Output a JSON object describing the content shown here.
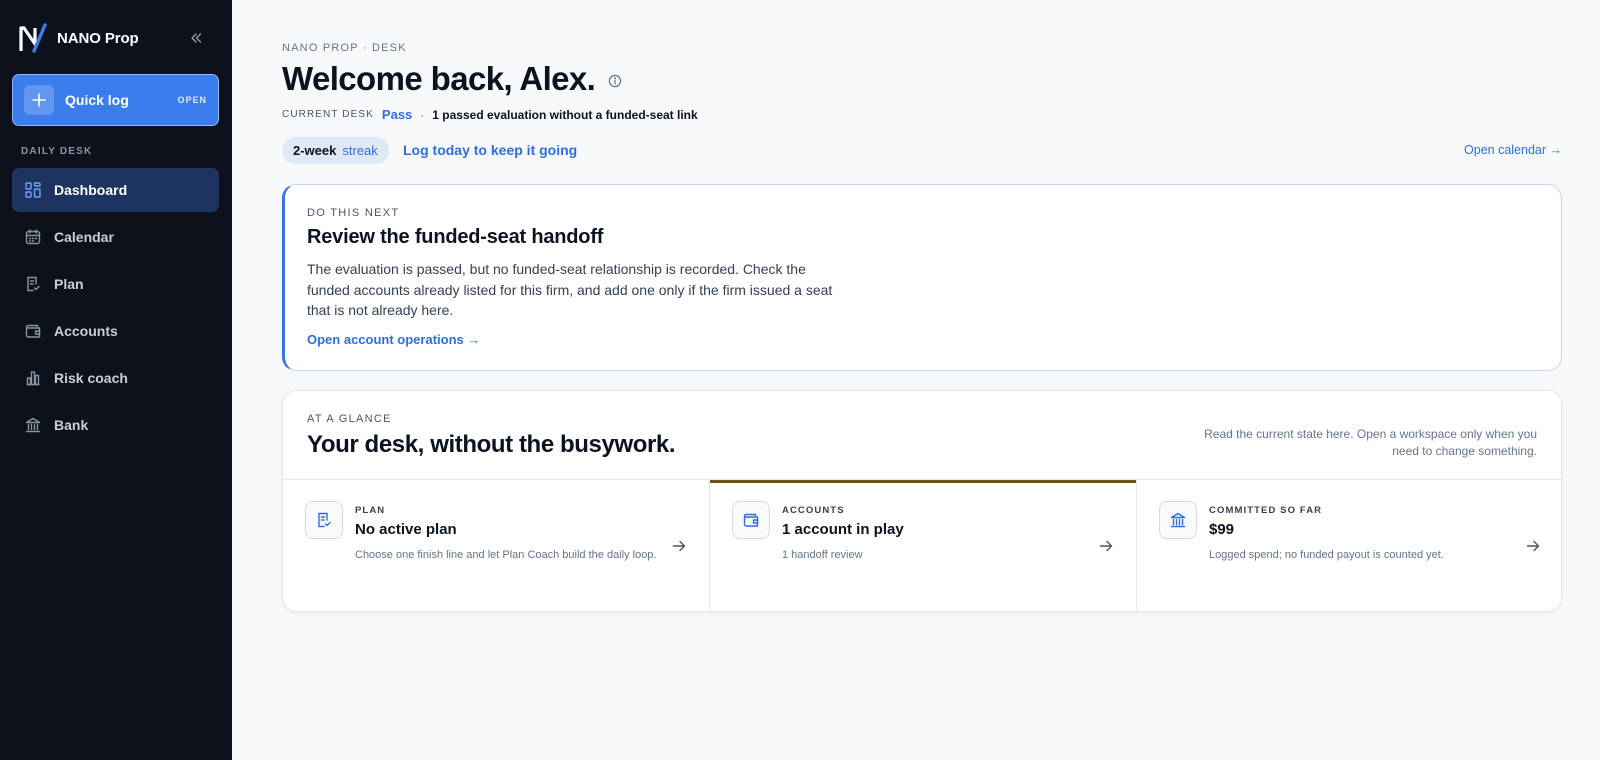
{
  "app": {
    "brand": "NANO Prop",
    "quick_log": {
      "label": "Quick log",
      "badge": "OPEN"
    },
    "nav_heading": "DAILY DESK",
    "nav": [
      {
        "label": "Dashboard",
        "icon": "dashboard-icon",
        "active": true
      },
      {
        "label": "Calendar",
        "icon": "calendar-icon",
        "active": false
      },
      {
        "label": "Plan",
        "icon": "plan-icon",
        "active": false
      },
      {
        "label": "Accounts",
        "icon": "wallet-icon",
        "active": false
      },
      {
        "label": "Risk coach",
        "icon": "bar-chart-icon",
        "active": false
      },
      {
        "label": "Bank",
        "icon": "bank-icon",
        "active": false
      }
    ]
  },
  "header": {
    "eyebrow": "NANO PROP · DESK",
    "title": "Welcome back, Alex.",
    "desk_label": "CURRENT DESK",
    "desk_status": "Pass",
    "desk_separator": "·",
    "desk_note": "1 passed evaluation without a funded-seat link",
    "streak_count": "2-week",
    "streak_word": "streak",
    "streak_cta": "Log today to keep it going",
    "open_calendar": "Open calendar →"
  },
  "next_action": {
    "eyebrow": "DO THIS NEXT",
    "title": "Review the funded-seat handoff",
    "body": "The evaluation is passed, but no funded-seat relationship is recorded. Check the funded accounts already listed for this firm, and add one only if the firm issued a seat that is not already here.",
    "link": "Open account operations →"
  },
  "glance": {
    "eyebrow": "AT A GLANCE",
    "title": "Your desk, without the busywork.",
    "note": "Read the current state here. Open a workspace only when you need to change something.",
    "tiles": [
      {
        "label": "PLAN",
        "value": "No active plan",
        "desc": "Choose one finish line and let Plan Coach build the daily loop.",
        "icon": "plan-check-icon"
      },
      {
        "label": "ACCOUNTS",
        "value": "1 account in play",
        "desc": "1 handoff review",
        "icon": "wallet-icon"
      },
      {
        "label": "COMMITTED SO FAR",
        "value": "$99",
        "desc": "Logged spend; no funded payout is counted yet.",
        "icon": "bank-icon"
      }
    ]
  },
  "colors": {
    "sidebar_bg": "#0c111c",
    "accent_blue": "#3b7ded",
    "link_blue": "#2f6fd7",
    "active_nav_bg": "#1d3461",
    "tile_accent": "#6b5514"
  }
}
